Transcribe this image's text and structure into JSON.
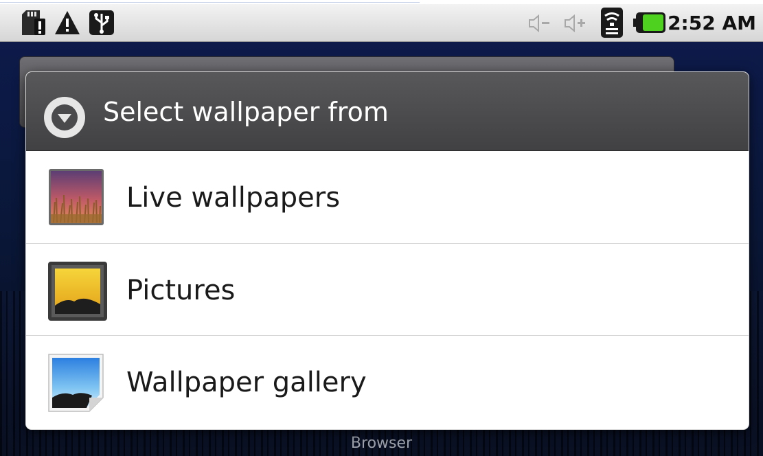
{
  "status_bar": {
    "icons_left": [
      "sd-card-alert-icon",
      "warning-icon",
      "usb-icon"
    ],
    "icons_right": [
      "volume-down-icon",
      "volume-up-icon",
      "wifi-icon",
      "battery-icon"
    ],
    "time": "2:52 AM"
  },
  "home": {
    "dock_label": "Browser"
  },
  "dialog": {
    "title": "Select wallpaper from",
    "title_icon": "dropdown-circle-icon",
    "options": [
      {
        "label": "Live wallpapers",
        "icon": "live-wallpaper-icon"
      },
      {
        "label": "Pictures",
        "icon": "pictures-icon"
      },
      {
        "label": "Wallpaper gallery",
        "icon": "wallpaper-gallery-icon"
      }
    ]
  },
  "colors": {
    "dialog_header": "#4a4a4c",
    "dialog_body": "#ffffff",
    "home_background": "#0b1530"
  }
}
